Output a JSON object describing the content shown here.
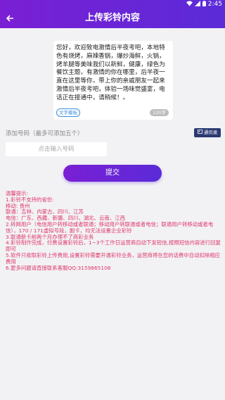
{
  "status": {
    "time": "2:45"
  },
  "header": {
    "title": "上传彩铃内容"
  },
  "content": {
    "text": "您好，欢迎致电激情后半夜考吧，本地特色有烧烤，麻辣香锅，爆炒海鲜，火锅，烤羊腿等美味我们以新鲜，健康，绿色为餐饮主题，有激情的你在哪里，后半夜一直在这里等你，带上你的亲戚朋友一起来激情后半夜考吧，体验一场味觉盛宴，电话正在接通中，请稍候！。",
    "template_button": "文字模板",
    "char_count": "120字"
  },
  "numbers": {
    "label": "添加号码（最多可添加五个）",
    "address_book_button": "通讯录",
    "input_placeholder": "点击输入号码"
  },
  "submit_button": "提交",
  "tips": [
    "温馨提示:",
    "1.彩铃不支持的省份:",
    "移动: 贵州",
    "联通：吉林、内蒙古、四川、江苏",
    "电信：广东、西藏、新疆、四川、湖北、云南、江西",
    "2.转网用户（电信用户转移动或者联通；移动用户转联通或者电信；联通用户转移动或者电信），170 / 171虚拟号段，副卡，均无法设置企业彩铃",
    "3.联通新卡前两个月办理不了商彩业务",
    "4.彩铃制作完成，付费设置彩铃后，1~3个工作日运营商自动下发短信,按照短信内容进行回复即可",
    "5.软件只收取彩铃上传费用,设置彩铃需要开通彩铃业务，运营商将在您的话费中自动扣除相应费用",
    "6.更多问题请直接联系客服QQ:3159865108"
  ]
}
